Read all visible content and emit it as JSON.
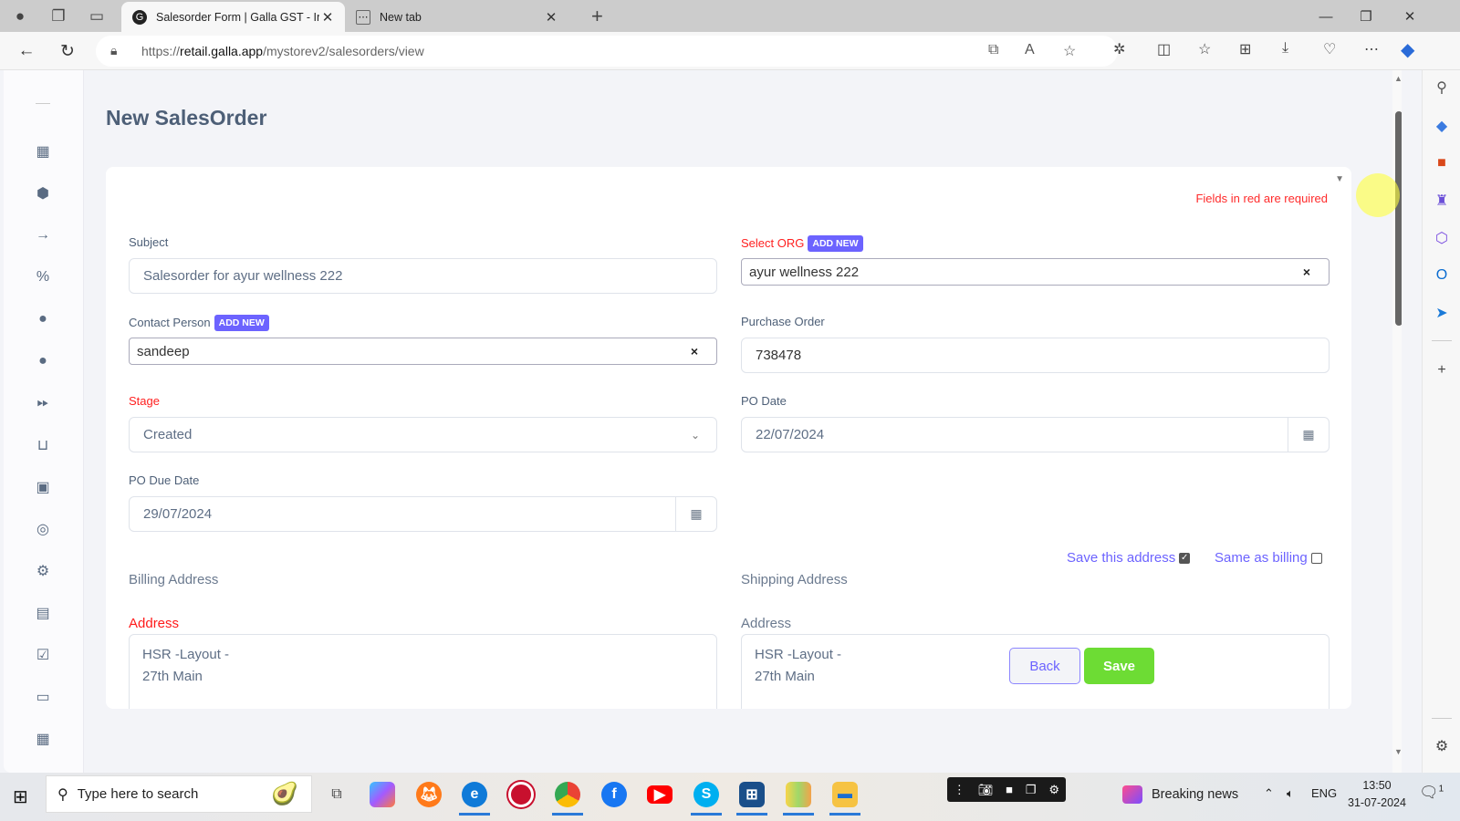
{
  "browser": {
    "tabs": [
      {
        "title": "Salesorder Form | Galla GST - Inv",
        "active": true
      },
      {
        "title": "New tab",
        "active": false
      }
    ],
    "url_prefix": "https://",
    "url_domain": "retail.galla.app",
    "url_path": "/mystorev2/salesorders/view"
  },
  "page": {
    "title": "New SalesOrder",
    "required_note": "Fields in red are required",
    "add_new_label": "ADD NEW"
  },
  "form": {
    "subject": {
      "label": "Subject",
      "value": "Salesorder for ayur wellness 222"
    },
    "org": {
      "label": "Select ORG",
      "value": "ayur wellness 222"
    },
    "contact": {
      "label": "Contact Person",
      "value": "sandeep"
    },
    "purchase_order": {
      "label": "Purchase Order",
      "value": "738478"
    },
    "stage": {
      "label": "Stage",
      "value": "Created"
    },
    "po_date": {
      "label": "PO Date",
      "value": "22/07/2024"
    },
    "po_due_date": {
      "label": "PO Due Date",
      "value": "29/07/2024"
    },
    "save_address": {
      "label": "Save this address",
      "checked": true
    },
    "same_as_billing": {
      "label": "Same as billing",
      "checked": false
    },
    "billing": {
      "section": "Billing Address",
      "address_label": "Address",
      "address_value": "HSR -Layout -\n27th Main"
    },
    "shipping": {
      "section": "Shipping Address",
      "address_label": "Address",
      "address_value": "HSR -Layout -\n27th Main"
    }
  },
  "actions": {
    "back": "Back",
    "save": "Save"
  },
  "taskbar": {
    "search_placeholder": "Type here to search",
    "news": "Breaking news",
    "language": "ENG",
    "time": "13:50",
    "date": "31-07-2024",
    "notifications": "1"
  },
  "colors": {
    "accent": "#6c63ff",
    "required": "#ff2020",
    "save": "#6ddc34"
  }
}
